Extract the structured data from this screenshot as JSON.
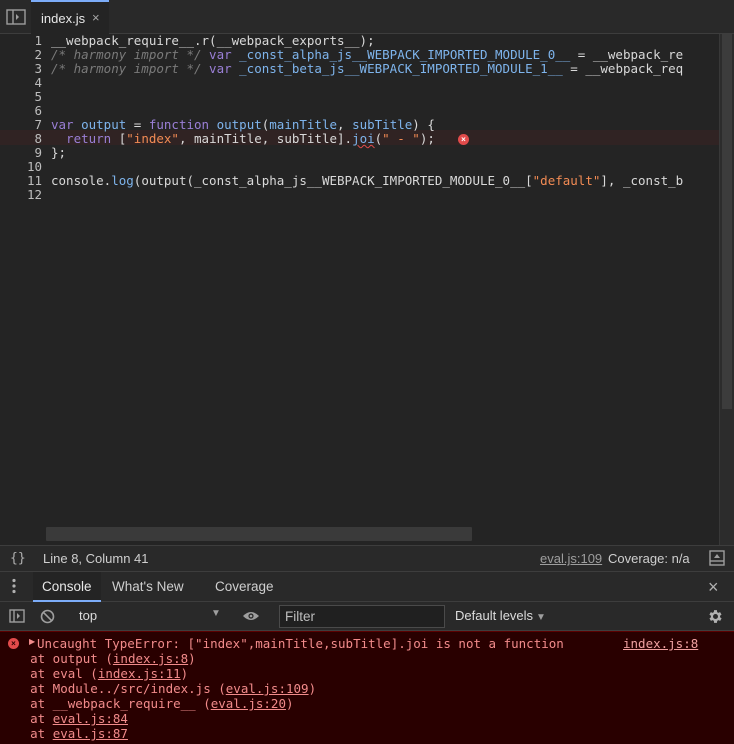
{
  "tab": {
    "label": "index.js",
    "close": "×"
  },
  "editor": {
    "line_numbers": [
      "1",
      "2",
      "3",
      "4",
      "5",
      "6",
      "7",
      "8",
      "9",
      "10",
      "11",
      "12"
    ],
    "lines": {
      "l1": "__webpack_require__.r(__webpack_exports__);",
      "l2_comment": "/* harmony import */",
      "l2_var": " var",
      "l2_name": " _const_alpha_js__WEBPACK_IMPORTED_MODULE_0__",
      "l2_rest": " = __webpack_re",
      "l3_comment": "/* harmony import */",
      "l3_var": " var",
      "l3_name": " _const_beta_js__WEBPACK_IMPORTED_MODULE_1__",
      "l3_rest": " = __webpack_req",
      "l7_var": "var",
      "l7_name": " output",
      "l7_eq": " = ",
      "l7_fn": "function",
      "l7_fname": " output",
      "l7_p1": "(",
      "l7_arg1": "mainTitle",
      "l7_comma": ", ",
      "l7_arg2": "subTitle",
      "l7_end": ") {",
      "l8_return": "  return",
      "l8_a": " [",
      "l8_s1": "\"index\"",
      "l8_b": ", mainTitle, subTitle].",
      "l8_joi": "joi",
      "l8_c": "(",
      "l8_s2": "\" - \"",
      "l8_d": ");",
      "l9": "};",
      "l11_a": "console.",
      "l11_log": "log",
      "l11_b": "(output(_const_alpha_js__WEBPACK_IMPORTED_MODULE_0__[",
      "l11_s": "\"default\"",
      "l11_c": "], _const_b"
    },
    "error_marker": "×"
  },
  "status": {
    "format_icon": "{}",
    "cursor_position": "Line 8, Column 41",
    "source_link": "eval.js:109",
    "coverage": "Coverage: n/a"
  },
  "drawer": {
    "tabs": [
      "Console",
      "What's New",
      "Coverage"
    ],
    "close": "×"
  },
  "console_toolbar": {
    "context": "top",
    "filter_placeholder": "Filter",
    "levels": "Default levels"
  },
  "console": {
    "error_message": "Uncaught TypeError: [\"index\",mainTitle,subTitle].joi is not a function",
    "error_location": "index.js:8",
    "stack": [
      {
        "prefix": "    at output (",
        "link": "index.js:8",
        "suffix": ")"
      },
      {
        "prefix": "    at eval (",
        "link": "index.js:11",
        "suffix": ")"
      },
      {
        "prefix": "    at Module../src/index.js (",
        "link": "eval.js:109",
        "suffix": ")"
      },
      {
        "prefix": "    at __webpack_require__ (",
        "link": "eval.js:20",
        "suffix": ")"
      },
      {
        "prefix": "    at ",
        "link": "eval.js:84",
        "suffix": ""
      },
      {
        "prefix": "    at ",
        "link": "eval.js:87",
        "suffix": ""
      }
    ]
  },
  "colors": {
    "accent": "#7cacf8",
    "error": "#e24b4b",
    "error_text": "#f28b8b",
    "error_bg": "#290000"
  }
}
